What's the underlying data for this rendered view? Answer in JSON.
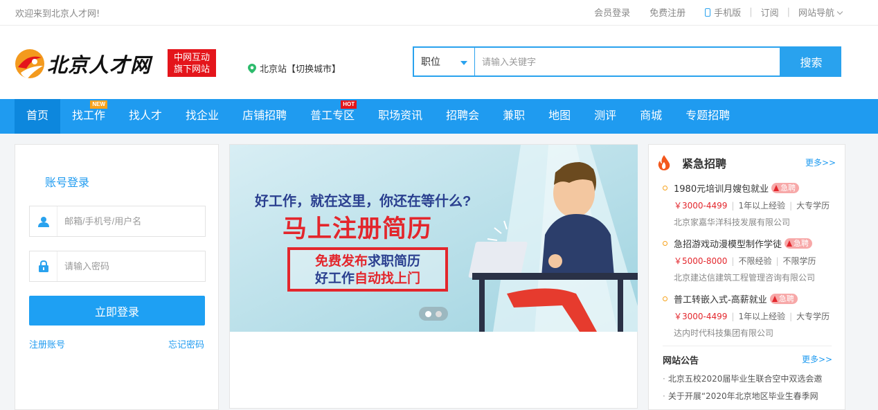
{
  "topbar": {
    "welcome": "欢迎来到北京人才网!",
    "links": [
      "会员登录",
      "免费注册"
    ],
    "mobile": "手机版",
    "subscribe": "订阅",
    "site_nav": "网站导航"
  },
  "header": {
    "logo_text": "北京人才网",
    "badge_line1": "中网互动",
    "badge_line2": "旗下网站",
    "city": "北京站【切换城市】",
    "search_category": "职位",
    "search_placeholder": "请输入关键字",
    "search_button": "搜索"
  },
  "nav": {
    "items": [
      "首页",
      "找工作",
      "找人才",
      "找企业",
      "店铺招聘",
      "普工专区",
      "职场资讯",
      "招聘会",
      "兼职",
      "地图",
      "测评",
      "商城",
      "专题招聘"
    ],
    "tag_new": "NEW",
    "tag_hot": "HOT"
  },
  "login": {
    "title": "账号登录",
    "username_placeholder": "邮箱/手机号/用户名",
    "password_placeholder": "请输入密码",
    "submit": "立即登录",
    "register": "注册账号",
    "forgot": "忘记密码"
  },
  "banner": {
    "line1": "好工作，就在这里，你还在等什么?",
    "line2": "马上注册简历",
    "box_a_red": "免费发布",
    "box_a_blue": "求职简历",
    "box_b_blue": "好工作",
    "box_b_red": "自动找上门",
    "slide_count": 2,
    "active_slide": 1
  },
  "urgent": {
    "title": "紧急招聘",
    "more": "更多>>",
    "badge": "急聘",
    "jobs": [
      {
        "name": "1980元培训月嫂包就业",
        "salary": "￥3000-4499",
        "exp": "1年以上经验",
        "edu": "大专学历",
        "company": "北京家嘉华洋科技发展有限公司"
      },
      {
        "name": "急招游戏动漫模型制作学徒",
        "salary": "￥5000-8000",
        "exp": "不限经验",
        "edu": "不限学历",
        "company": "北京建达信建筑工程管理咨询有限公司"
      },
      {
        "name": "普工转嵌入式-高薪就业",
        "salary": "￥3000-4499",
        "exp": "1年以上经验",
        "edu": "大专学历",
        "company": "达内时代科技集团有限公司"
      }
    ]
  },
  "notices": {
    "title": "网站公告",
    "more": "更多>>",
    "items": [
      "北京五校2020届毕业生联合空中双选会邀",
      "关于开展“2020年北京地区毕业生春季网"
    ]
  },
  "colors": {
    "primary": "#1f9bf0",
    "red": "#e4151b",
    "orange": "#f7a21b"
  }
}
